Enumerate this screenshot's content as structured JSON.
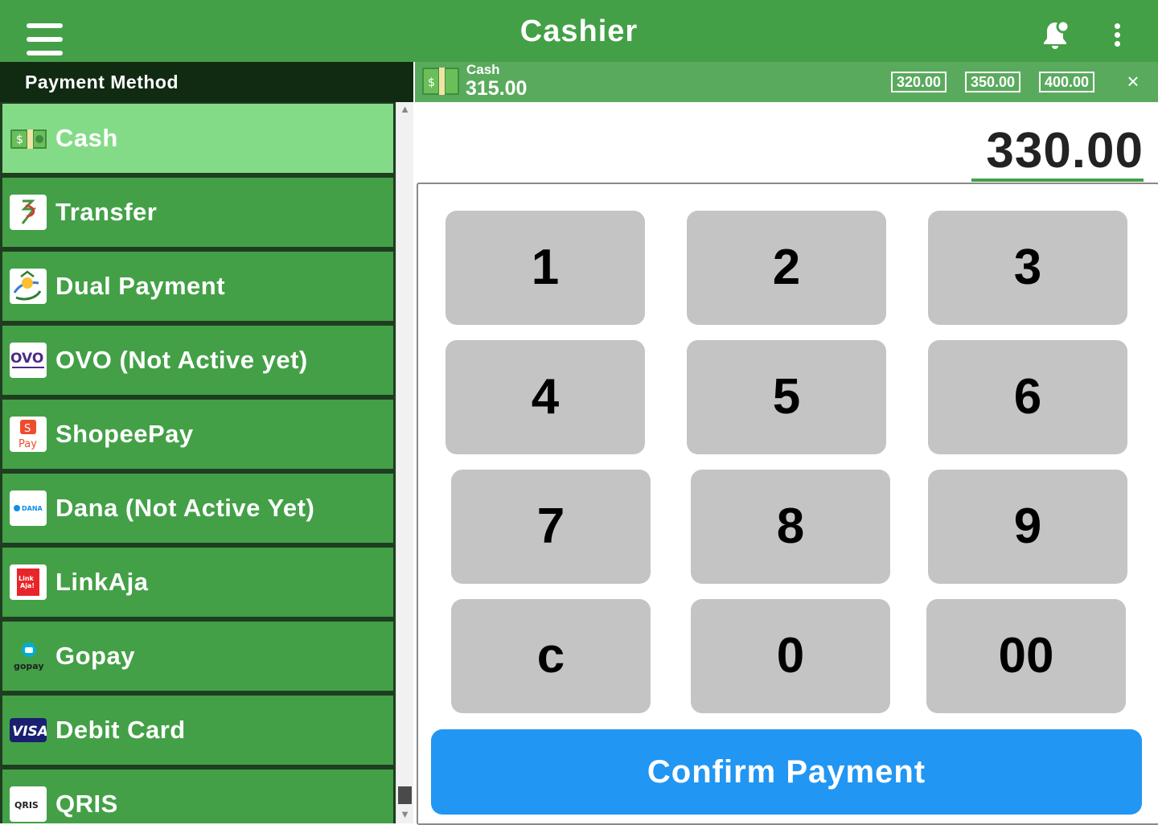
{
  "app": {
    "title": "Cashier"
  },
  "header_icons": [
    "menu-icon",
    "notification-bell-icon",
    "more-vert-icon"
  ],
  "colors": {
    "primary": "#43a047",
    "dark_header": "#112a12",
    "selected": "#84db87",
    "key_bg": "#c4c4c4",
    "confirm": "#2196f3"
  },
  "payment_panel": {
    "header": "Payment Method",
    "items": [
      {
        "label": "Cash",
        "icon": "cash-icon",
        "selected": true
      },
      {
        "label": "Transfer",
        "icon": "transfer-icon"
      },
      {
        "label": "Dual Payment",
        "icon": "dual-payment-icon"
      },
      {
        "label": "OVO (Not Active yet)",
        "icon": "ovo-icon",
        "icon_text": "OVO"
      },
      {
        "label": "ShopeePay",
        "icon": "shopeepay-icon",
        "icon_text": "Pay"
      },
      {
        "label": "Dana (Not Active Yet)",
        "icon": "dana-icon",
        "icon_text": "DANA"
      },
      {
        "label": "LinkAja",
        "icon": "linkaja-icon",
        "icon_text": "Link Aja!"
      },
      {
        "label": "Gopay",
        "icon": "gopay-icon",
        "icon_text": "gopay"
      },
      {
        "label": "Debit Card",
        "icon": "visa-icon",
        "icon_text": "VISA"
      },
      {
        "label": "QRIS",
        "icon": "qris-icon",
        "icon_text": "QRIS"
      }
    ]
  },
  "cash_bar": {
    "label": "Cash",
    "amount": "315.00",
    "quick_amounts": [
      "320.00",
      "350.00",
      "400.00"
    ],
    "close": "×"
  },
  "amount_display": "330.00",
  "keypad": {
    "keys": [
      "1",
      "2",
      "3",
      "4",
      "5",
      "6",
      "7",
      "8",
      "9",
      "c",
      "0",
      "00"
    ]
  },
  "confirm_label": "Confirm Payment"
}
